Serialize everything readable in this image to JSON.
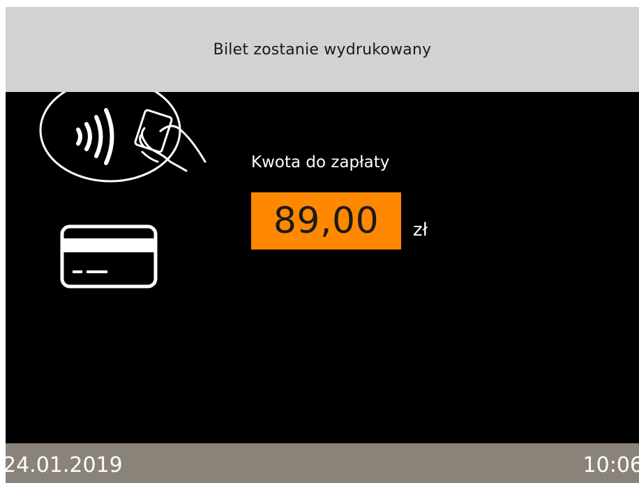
{
  "header": {
    "title": "Bilet zostanie wydrukowany"
  },
  "payment": {
    "amount_label": "Kwota do zapłaty",
    "amount": "89,00",
    "currency": "zł",
    "accent_color": "#ff8800"
  },
  "icons": {
    "contactless": "contactless-payment-icon",
    "card": "credit-card-icon"
  },
  "footer": {
    "date": "24.01.2019",
    "time": "10:06"
  }
}
